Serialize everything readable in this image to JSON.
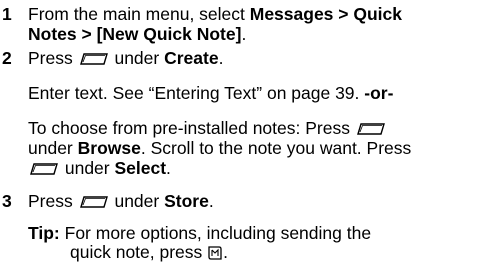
{
  "steps": [
    {
      "number": "1",
      "lines": [
        {
          "pre": "From the main menu, select ",
          "bold": "Messages > Quick"
        },
        {
          "bold": "Notes > [New Quick Note]",
          "post": "."
        }
      ]
    },
    {
      "number": "2",
      "pre": "Press ",
      "icon": "softkey-icon",
      "mid": " under ",
      "bold": "Create",
      "post": "."
    },
    {
      "number": "3",
      "pre": "Press ",
      "icon": "softkey-icon",
      "mid": " under ",
      "bold": "Store",
      "post": "."
    }
  ],
  "enter_text": {
    "text": "Enter text. See “Entering Text” on page 39. ",
    "or": "-or-"
  },
  "preinstalled": {
    "l1_pre": "To choose from pre-installed notes: Press ",
    "l2_pre": "under ",
    "l2_bold": "Browse",
    "l2_post": ". Scroll to the note you want. Press",
    "l3_pre": " under ",
    "l3_bold": "Select",
    "l3_post": "."
  },
  "tip": {
    "label": "Tip:",
    "l1": " For more options, including sending the",
    "l2": "quick note, press ",
    "l2_post": "."
  }
}
